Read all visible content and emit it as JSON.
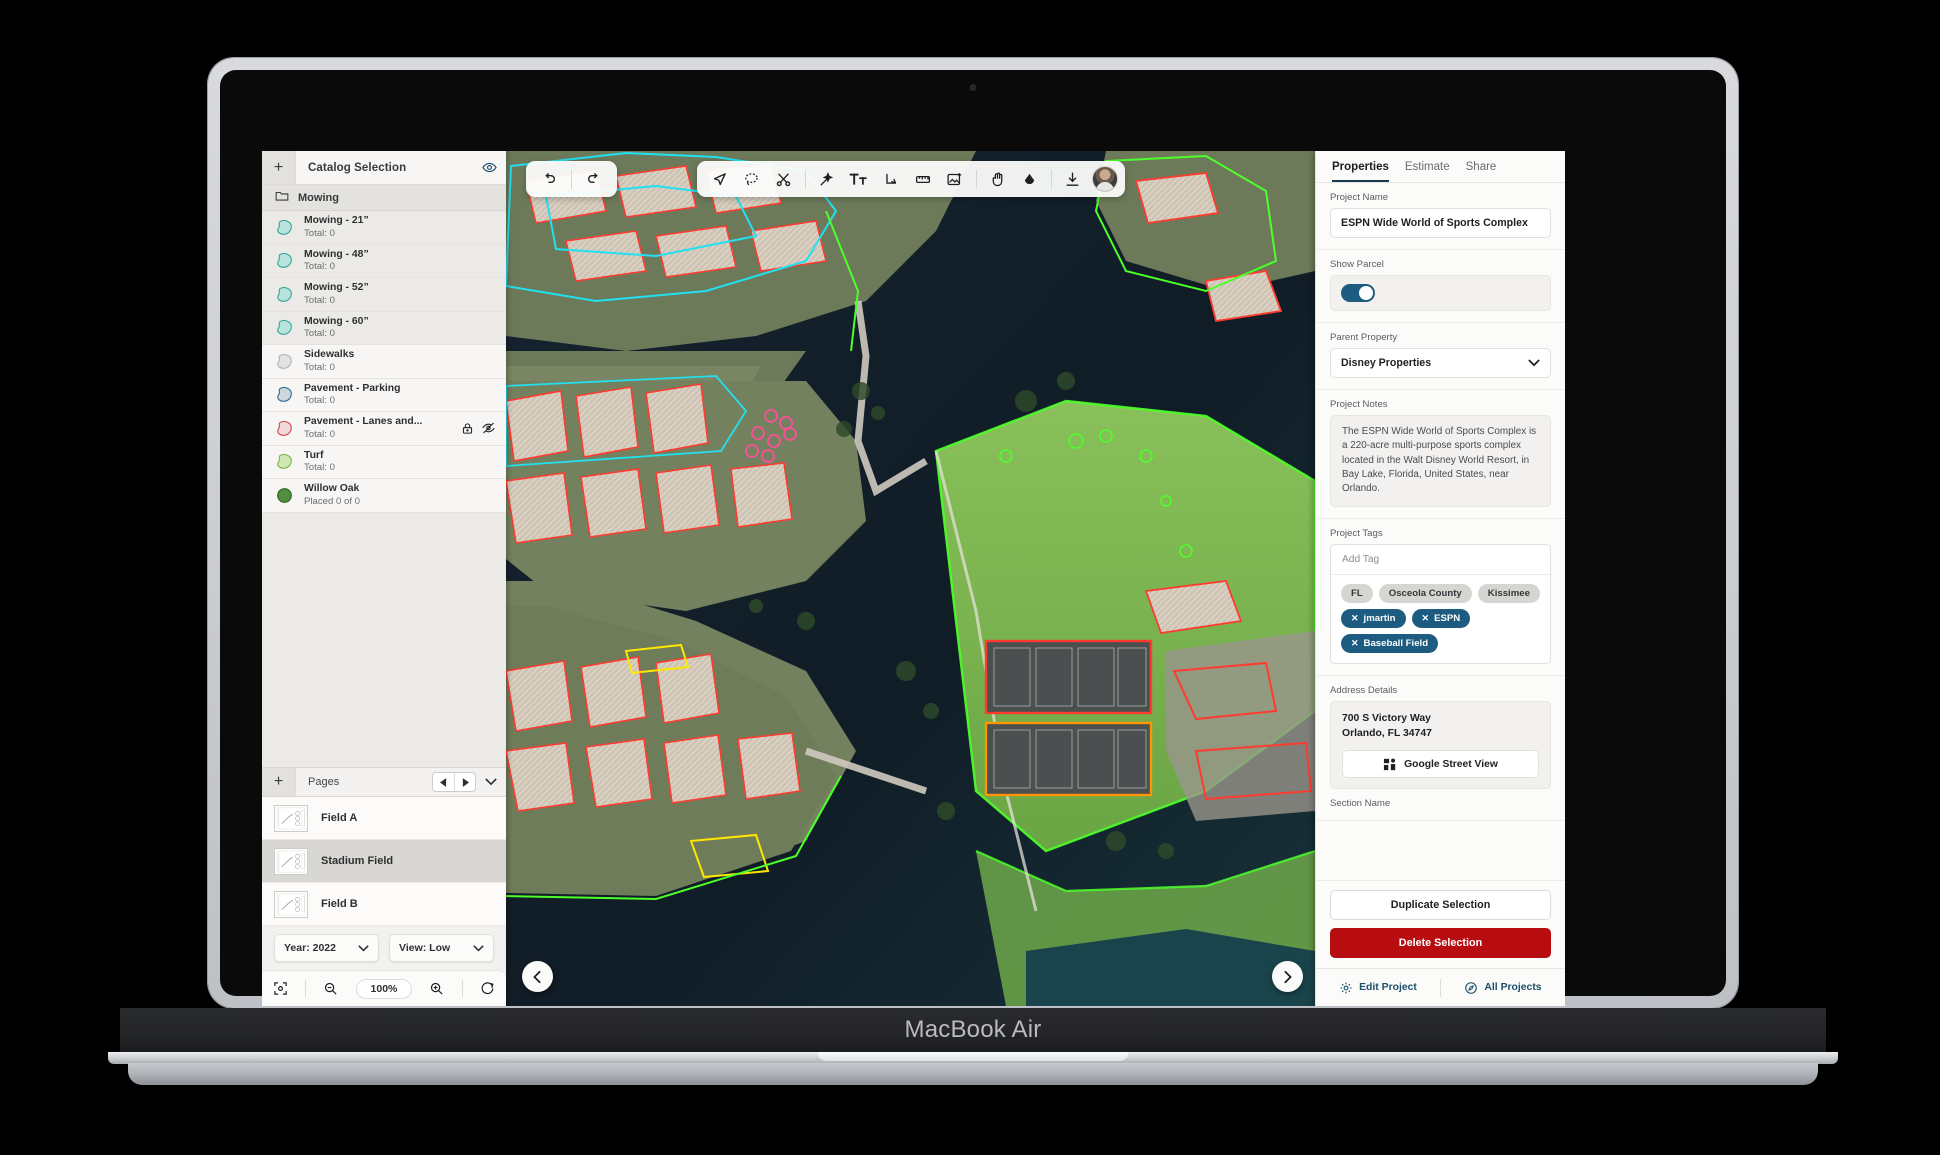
{
  "device": {
    "label": "MacBook Air"
  },
  "sidebar": {
    "header": {
      "add_label": "+",
      "title": "Catalog Selection",
      "visibility_icon": "eye-icon"
    },
    "folder": {
      "label": "Mowing",
      "icon": "folder-icon"
    },
    "items": [
      {
        "name": "Mowing - 21”",
        "total": "Total: 0",
        "swatch": "#b9e4dd",
        "stroke": "#3aa79a",
        "locked": false,
        "hidden": false
      },
      {
        "name": "Mowing - 48”",
        "total": "Total: 0",
        "swatch": "#b9e4dd",
        "stroke": "#3aa79a",
        "locked": false,
        "hidden": false
      },
      {
        "name": "Mowing - 52”",
        "total": "Total: 0",
        "swatch": "#b9e4dd",
        "stroke": "#3aa79a",
        "locked": false,
        "hidden": false
      },
      {
        "name": "Mowing - 60”",
        "total": "Total: 0",
        "swatch": "#b9e4dd",
        "stroke": "#3aa79a",
        "locked": false,
        "hidden": false
      },
      {
        "name": "Sidewalks",
        "total": "Total: 0",
        "swatch": "#e2e2e2",
        "stroke": "#b4b4b4",
        "locked": false,
        "hidden": false
      },
      {
        "name": "Pavement - Parking",
        "total": "Total: 0",
        "swatch": "#cfd7dc",
        "stroke": "#2d6f93",
        "locked": false,
        "hidden": false
      },
      {
        "name": "Pavement - Lanes and...",
        "total": "Total: 0",
        "swatch": "#f0d9da",
        "stroke": "#d04a52",
        "locked": true,
        "hidden": true
      },
      {
        "name": "Turf",
        "total": "Total: 0",
        "swatch": "#cfe8b2",
        "stroke": "#7fb448",
        "locked": false,
        "hidden": false
      },
      {
        "name": "Willow Oak",
        "total": "Placed 0 of 0",
        "swatch": "#4f8f3f",
        "stroke": "#2f6626",
        "shape": "circle",
        "locked": false,
        "hidden": false
      }
    ],
    "pages": {
      "add_label": "+",
      "title": "Pages",
      "prev_icon": "triangle-left-icon",
      "next_icon": "triangle-right-icon",
      "collapse_icon": "chevron-down-icon",
      "list": [
        {
          "name": "Field A",
          "selected": false
        },
        {
          "name": "Stadium Field",
          "selected": true
        },
        {
          "name": "Field B",
          "selected": false
        }
      ]
    },
    "controls": {
      "year": "Year: 2022",
      "view": "View: Low",
      "fit_icon": "fit-to-screen-icon",
      "zoom_out_icon": "zoom-out-icon",
      "zoom_level": "100%",
      "zoom_in_icon": "zoom-in-icon",
      "reset_icon": "rotate-cw-icon"
    }
  },
  "map": {
    "history": {
      "undo_icon": "undo-icon",
      "redo_icon": "redo-icon"
    },
    "tools": [
      {
        "icon": "cursor-pointer-icon"
      },
      {
        "icon": "lasso-select-icon"
      },
      {
        "icon": "scissors-cut-icon"
      },
      {
        "icon": "magic-wand-icon"
      },
      {
        "icon": "text-tool-icon"
      },
      {
        "icon": "arrow-down-right-icon"
      },
      {
        "icon": "measure-ruler-icon"
      },
      {
        "icon": "add-image-icon"
      },
      {
        "icon": "pan-hand-icon"
      },
      {
        "icon": "water-drop-icon"
      },
      {
        "icon": "download-icon"
      },
      {
        "icon": "user-avatar"
      }
    ],
    "nav": {
      "prev_icon": "chevron-left-icon",
      "next_icon": "chevron-right-icon"
    }
  },
  "properties": {
    "tabs": [
      {
        "label": "Properties",
        "active": true
      },
      {
        "label": "Estimate",
        "active": false
      },
      {
        "label": "Share",
        "active": false
      }
    ],
    "project_name": {
      "label": "Project Name",
      "value": "ESPN Wide World of Sports Complex"
    },
    "show_parcel": {
      "label": "Show Parcel",
      "on": true
    },
    "parent_property": {
      "label": "Parent Property",
      "value": "Disney Properties",
      "chevron": "chevron-down-icon"
    },
    "project_notes": {
      "label": "Project Notes",
      "value": "The ESPN Wide World of Sports Complex is a 220-acre multi-purpose sports complex located in the Walt Disney World Resort, in Bay Lake, Florida, United States, near Orlando."
    },
    "project_tags": {
      "label": "Project Tags",
      "placeholder": "Add Tag",
      "tags": [
        {
          "label": "FL",
          "removable": false
        },
        {
          "label": "Osceola County",
          "removable": false
        },
        {
          "label": "Kissimee",
          "removable": false
        },
        {
          "label": "jmartin",
          "removable": true
        },
        {
          "label": "ESPN",
          "removable": true
        },
        {
          "label": "Baseball Field",
          "removable": true
        }
      ]
    },
    "address_details": {
      "label": "Address Details",
      "line1": "700 S Victory Way",
      "line2": "Orlando, FL 34747",
      "street_view_button": "Google Street View"
    },
    "section_name_label": "Section Name",
    "actions": {
      "duplicate": "Duplicate Selection",
      "delete": "Delete Selection"
    },
    "footer": {
      "edit_project": "Edit Project",
      "all_projects": "All Projects"
    }
  },
  "colors": {
    "accent": "#163a4e",
    "danger": "#b70c10",
    "chip_blue": "#1d5c80",
    "toggle_on": "#1d5c80"
  }
}
